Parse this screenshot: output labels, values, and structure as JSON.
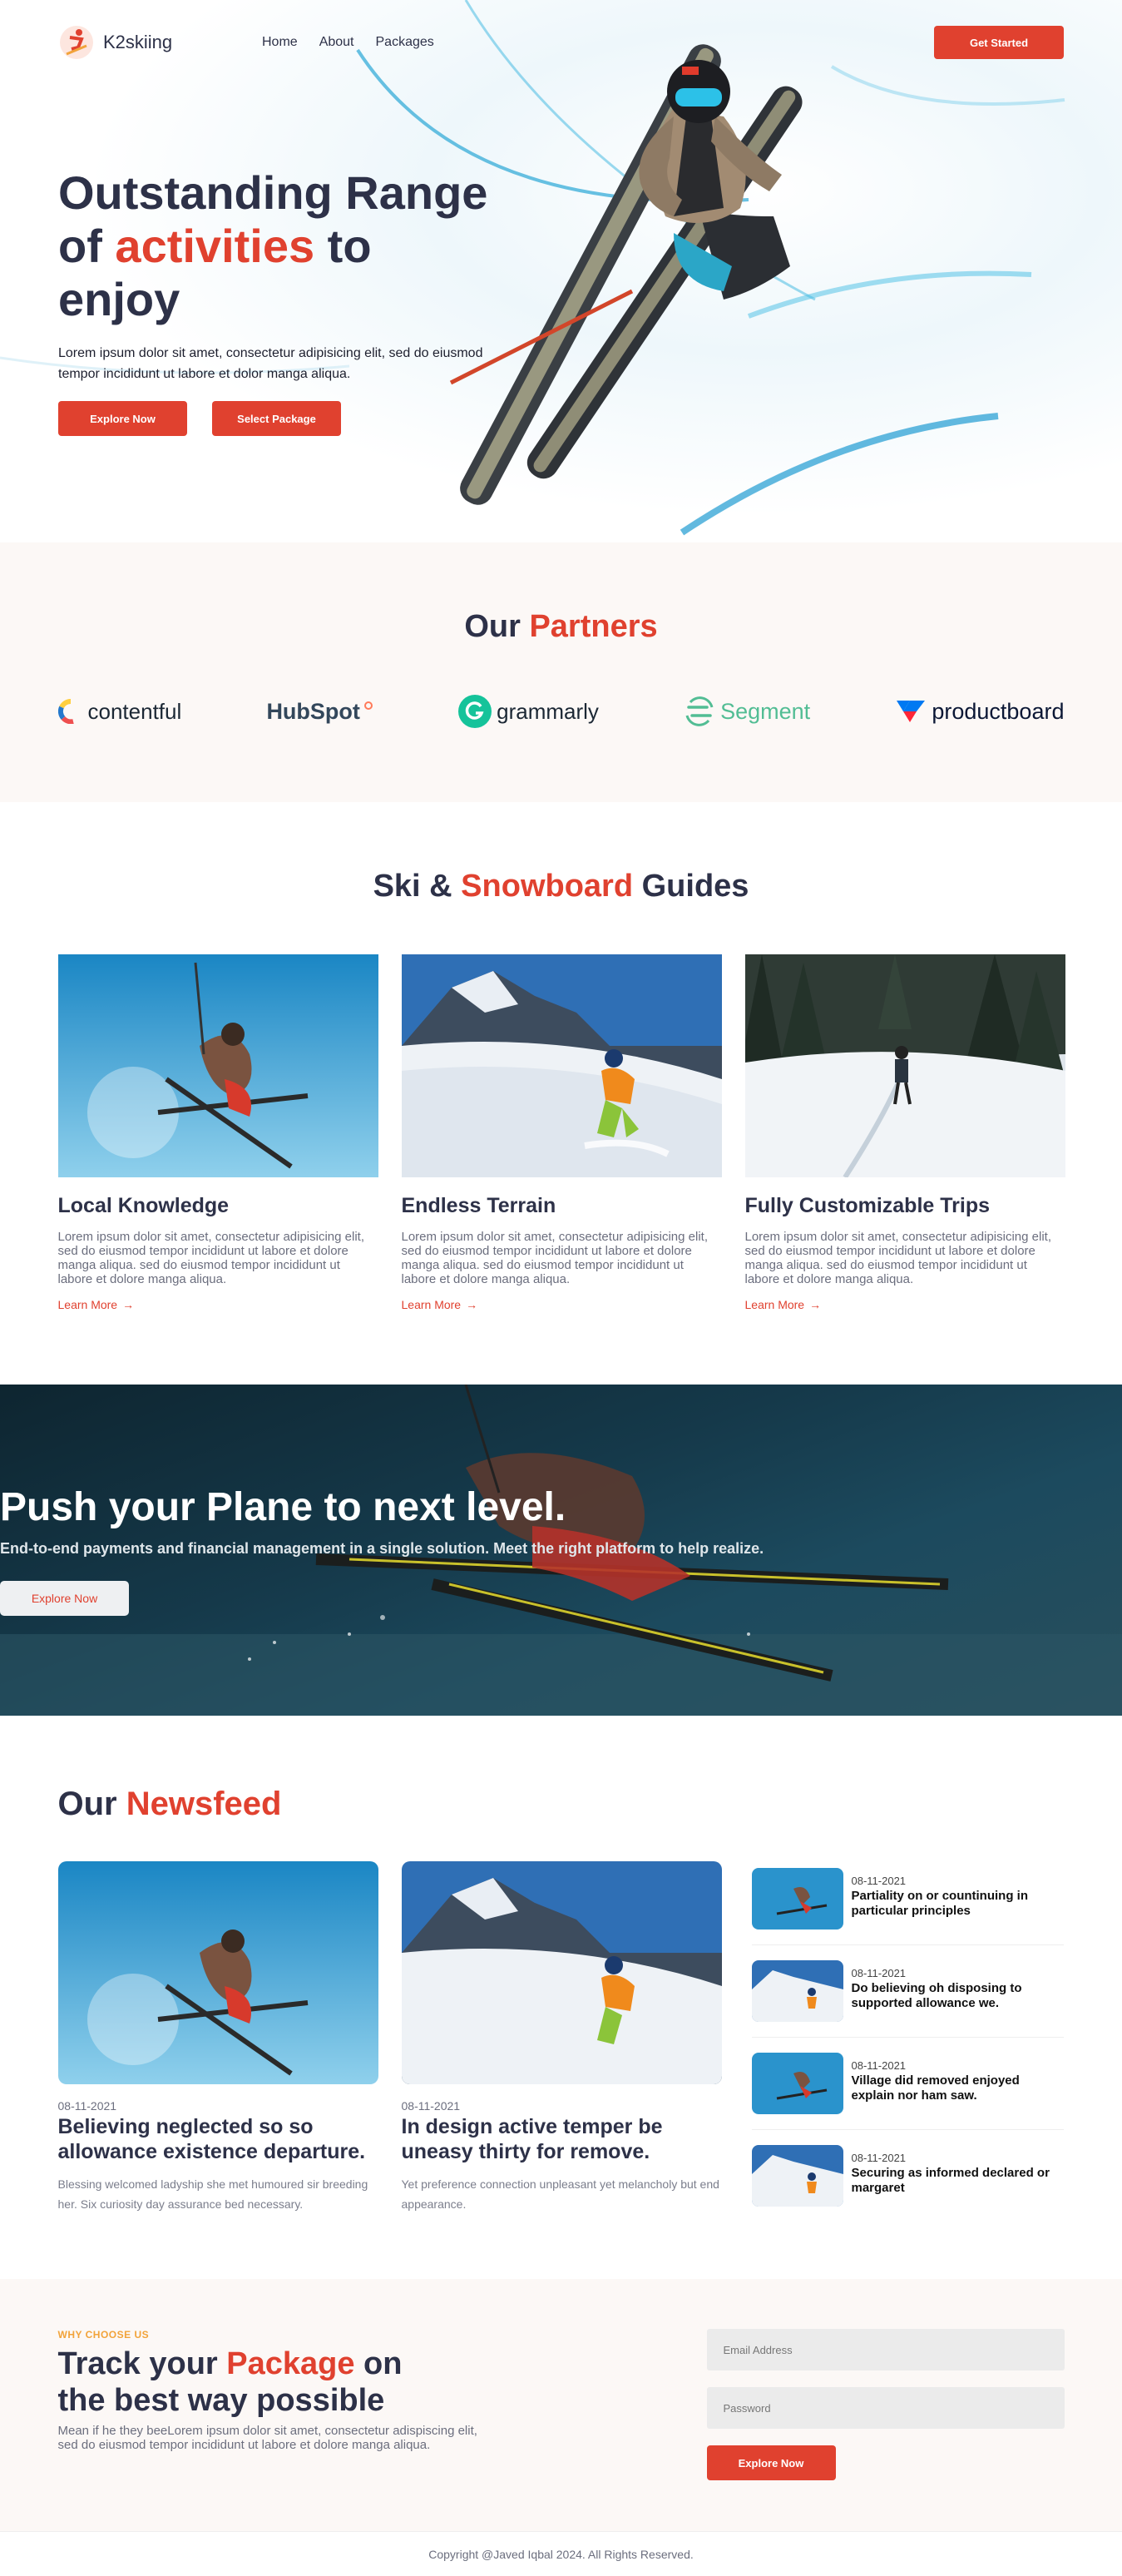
{
  "nav": {
    "brand": "K2skiing",
    "links": [
      "Home",
      "About",
      "Packages"
    ],
    "cta": "Get Started"
  },
  "hero": {
    "title_line1": "Outstanding Range",
    "title_pre": "of ",
    "title_accent": "activities",
    "title_post": " to",
    "title_line3": "enjoy",
    "description": "Lorem ipsum dolor sit amet, consectetur adipisicing elit, sed do eiusmod tempor incididunt ut labore et dolor manga aliqua.",
    "btn_explore": "Explore Now",
    "btn_package": "Select Package"
  },
  "partners": {
    "title_pre": "Our ",
    "title_accent": "Partners",
    "items": [
      "contentful",
      "HubSpot",
      "grammarly",
      "Segment",
      "productboard"
    ]
  },
  "guides": {
    "title_pre": "Ski & ",
    "title_accent": "Snowboard",
    "title_post": " Guides",
    "cards": [
      {
        "title": "Local Knowledge",
        "desc": "Lorem ipsum dolor sit amet, consectetur adipisicing elit, sed do eiusmod tempor incididunt ut labore et dolore manga aliqua. sed do eiusmod tempor incididunt ut labore et dolore manga aliqua.",
        "link": "Learn More"
      },
      {
        "title": "Endless Terrain",
        "desc": "Lorem ipsum dolor sit amet, consectetur adipisicing elit, sed do eiusmod tempor incididunt ut labore et dolore manga aliqua. sed do eiusmod tempor incididunt ut labore et dolore manga aliqua.",
        "link": "Learn More"
      },
      {
        "title": "Fully Customizable Trips",
        "desc": "Lorem ipsum dolor sit amet, consectetur adipisicing elit, sed do eiusmod tempor incididunt ut labore et dolore manga aliqua. sed do eiusmod tempor incididunt ut labore et dolore manga aliqua.",
        "link": "Learn More"
      }
    ]
  },
  "banner": {
    "title": "Push your Plane to next level.",
    "subtitle": "End-to-end payments and financial management in a single solution. Meet the right platform to help realize.",
    "button": "Explore Now"
  },
  "news": {
    "title_pre": "Our ",
    "title_accent": "Newsfeed",
    "cards": [
      {
        "date": "08-11-2021",
        "title": "Believing neglected so so allowance existence departure.",
        "desc": "Blessing welcomed ladyship she met humoured sir breeding her. Six curiosity day assurance bed necessary."
      },
      {
        "date": "08-11-2021",
        "title": "In design active temper be uneasy thirty for remove.",
        "desc": "Yet preference connection unpleasant yet melancholy but end appearance."
      }
    ],
    "list": [
      {
        "date": "08-11-2021",
        "title": "Partiality on or countinuing in particular principles"
      },
      {
        "date": "08-11-2021",
        "title": "Do believing oh disposing to supported allowance we."
      },
      {
        "date": "08-11-2021",
        "title": "Village did removed enjoyed explain nor ham saw."
      },
      {
        "date": "08-11-2021",
        "title": "Securing as informed declared or margaret"
      }
    ]
  },
  "track": {
    "eyebrow": "WHY CHOOSE US",
    "title_pre": "Track your ",
    "title_accent": "Package",
    "title_post": " on",
    "title_line2": "the best way possible",
    "desc": "Mean if he they beeLorem ipsum dolor sit amet, consectetur adispiscing elit, sed do eiusmod tempor incididunt ut labore et dolore manga aliqua.",
    "email_placeholder": "Email Address",
    "password_placeholder": "Password",
    "button": "Explore Now"
  },
  "footer": {
    "text": "Copyright @Javed Iqbal 2024. All Rights Reserved."
  },
  "colors": {
    "accent": "#e0412f",
    "dark": "#2d3148",
    "eyebrow": "#f2a33a"
  }
}
